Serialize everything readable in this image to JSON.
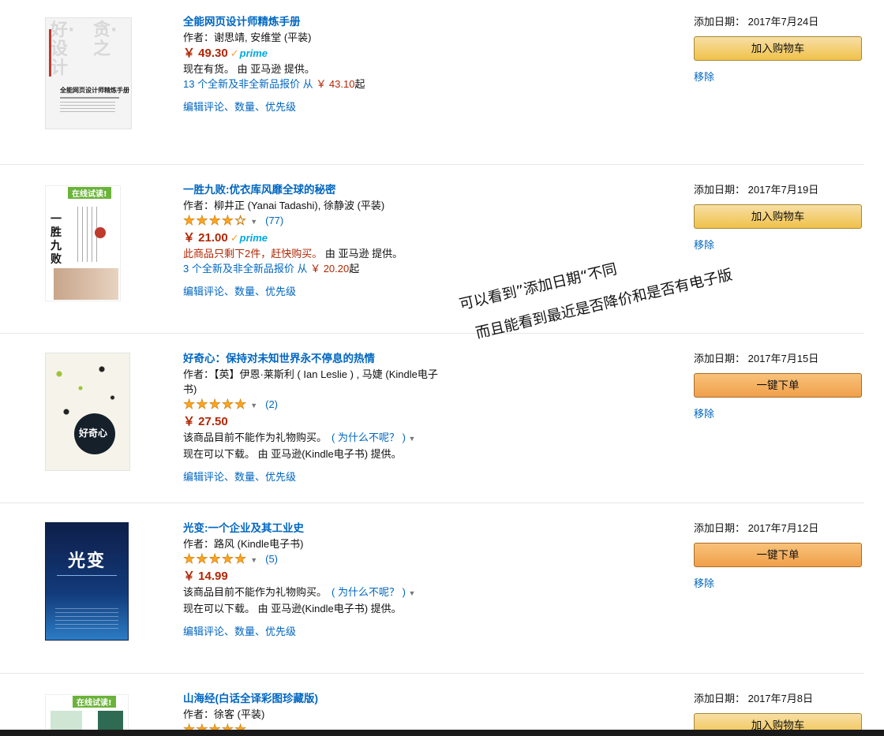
{
  "annotation": {
    "line1": "可以看到”添加日期“不同",
    "line2": "而且能看到最近是否降价和是否有电子版"
  },
  "colors": {
    "link": "#0066c0",
    "price": "#b12704",
    "cart_button": "#f0c14b",
    "one_click_button": "#f0a04b",
    "star": "#ffa41c",
    "prime": "#00a8e1"
  },
  "items": [
    {
      "title": "全能网页设计师精炼手册",
      "author": "作者：谢思靖, 安维堂 (平装)",
      "price": "￥ 49.30",
      "prime": "prime",
      "availability": "现在有货。 由 亚马逊 提供。",
      "offers_text": "13 个全新及非全新品报价 从",
      "offers_price": "￥ 43.10",
      "offers_suffix": "起",
      "edit": "编辑评论、数量、优先级",
      "date": "添加日期： 2017年7月24日",
      "button": "加入购物车",
      "remove": "移除",
      "cover": {
        "big1": "好·设计",
        "big2": "贪·之",
        "title": "全能网页设计师精炼手册"
      }
    },
    {
      "title": "一胜九败:优衣库风靡全球的秘密",
      "author": "作者：柳井正 (Yanai Tadashi), 徐静波 (平装)",
      "rating": 3.5,
      "stars": "★★★★☆",
      "reviews": "(77)",
      "price": "￥ 21.00",
      "prime": "prime",
      "availability_warn": "此商品只剩下2件，赶快购买。",
      "availability_rest": " 由 亚马逊 提供。",
      "offers_text": "3 个全新及非全新品报价 从",
      "offers_price": "￥ 20.20",
      "offers_suffix": "起",
      "edit": "编辑评论、数量、优先级",
      "date": "添加日期： 2017年7月19日",
      "button": "加入购物车",
      "remove": "移除",
      "cover": {
        "banner": "在线试读!",
        "title": "一胜九败"
      }
    },
    {
      "title": "好奇心：保持对未知世界永不停息的热情",
      "author": "作者：【英】伊恩·莱斯利 ( Ian Leslie ) , 马婕 (Kindle电子书)",
      "rating": 4.5,
      "stars": "★★★★★",
      "reviews": "(2)",
      "price": "￥ 27.50",
      "gift_note": "该商品目前不能作为礼物购买。",
      "why": "( 为什么不呢？ )",
      "availability": "现在可以下载。 由 亚马逊(Kindle电子书) 提供。",
      "edit": "编辑评论、数量、优先级",
      "date": "添加日期： 2017年7月15日",
      "button": "一键下单",
      "remove": "移除",
      "cover": {
        "title": "好奇心"
      }
    },
    {
      "title": "光变:一个企业及其工业史",
      "author": "作者：路风 (Kindle电子书)",
      "rating": 5,
      "stars": "★★★★★",
      "reviews": "(5)",
      "price": "￥ 14.99",
      "gift_note": "该商品目前不能作为礼物购买。",
      "why": "( 为什么不呢？ )",
      "availability": "现在可以下载。 由 亚马逊(Kindle电子书) 提供。",
      "edit": "编辑评论、数量、优先级",
      "date": "添加日期： 2017年7月12日",
      "button": "一键下单",
      "remove": "移除",
      "cover": {
        "title": "光变"
      }
    },
    {
      "title": "山海经(白话全译彩图珍藏版)",
      "author": "作者：徐客 (平装)",
      "stars": "★★★★★",
      "date": "添加日期： 2017年7月8日",
      "button": "加入购物车",
      "cover": {
        "banner": "在线试读!"
      }
    }
  ]
}
